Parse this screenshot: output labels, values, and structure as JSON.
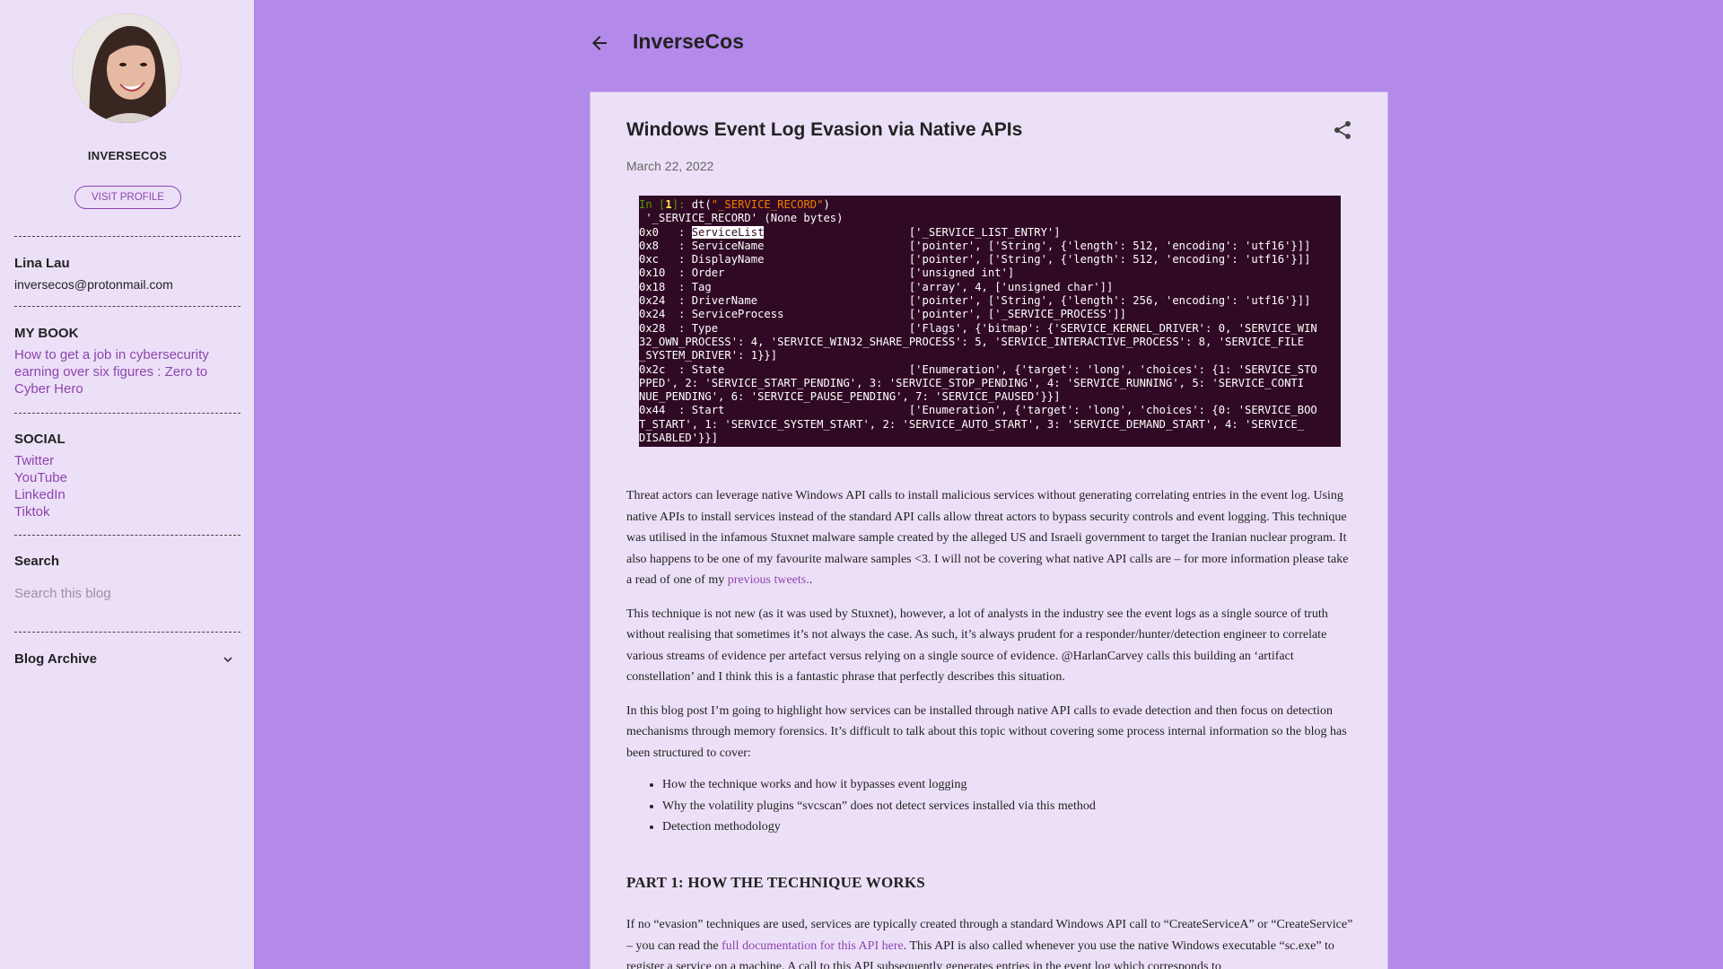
{
  "sidebar": {
    "profile_name": "INVERSECOS",
    "visit_profile": "VISIT PROFILE",
    "author": {
      "name": "Lina Lau",
      "email": "inversecos@protonmail.com"
    },
    "my_book": {
      "heading": "MY BOOK",
      "link": "How to get a job in cybersecurity earning over six figures : Zero to Cyber Hero"
    },
    "social": {
      "heading": "SOCIAL",
      "links": [
        "Twitter",
        "YouTube",
        "LinkedIn",
        "Tiktok"
      ]
    },
    "search": {
      "heading": "Search",
      "placeholder": "Search this blog"
    },
    "archive": {
      "heading": "Blog Archive"
    }
  },
  "header": {
    "title": "InverseCos"
  },
  "post": {
    "title": "Windows Event Log Evasion via Native APIs",
    "date": "March 22, 2022",
    "terminal": {
      "prompt_in": "In [",
      "prompt_num": "1",
      "prompt_close": "]: ",
      "command_pre": "dt(",
      "command_arg": "\"_SERVICE_RECORD\"",
      "command_post": ")",
      "lines": [
        " '_SERVICE_RECORD' (None bytes)",
        "0x8   : ServiceName                      ['pointer', ['String', {'length': 512, 'encoding': 'utf16'}]]",
        "0xc   : DisplayName                      ['pointer', ['String', {'length': 512, 'encoding': 'utf16'}]]",
        "0x10  : Order                            ['unsigned int']",
        "0x18  : Tag                              ['array', 4, ['unsigned char']]",
        "0x24  : DriverName                       ['pointer', ['String', {'length': 256, 'encoding': 'utf16'}]]",
        "0x24  : ServiceProcess                   ['pointer', ['_SERVICE_PROCESS']]",
        "0x28  : Type                             ['Flags', {'bitmap': {'SERVICE_KERNEL_DRIVER': 0, 'SERVICE_WIN",
        "32_OWN_PROCESS': 4, 'SERVICE_WIN32_SHARE_PROCESS': 5, 'SERVICE_INTERACTIVE_PROCESS': 8, 'SERVICE_FILE",
        "_SYSTEM_DRIVER': 1}}]",
        "0x2c  : State                            ['Enumeration', {'target': 'long', 'choices': {1: 'SERVICE_STO",
        "PPED', 2: 'SERVICE_START_PENDING', 3: 'SERVICE_STOP_PENDING', 4: 'SERVICE_RUNNING', 5: 'SERVICE_CONTI",
        "NUE_PENDING', 6: 'SERVICE_PAUSE_PENDING', 7: 'SERVICE_PAUSED'}}]",
        "0x44  : Start                            ['Enumeration', {'target': 'long', 'choices': {0: 'SERVICE_BOO",
        "T_START', 1: 'SERVICE_SYSTEM_START', 2: 'SERVICE_AUTO_START', 3: 'SERVICE_DEMAND_START', 4: 'SERVICE_",
        "DISABLED'}}]"
      ],
      "row0_prefix": "0x0   : ",
      "row0_field": "ServiceList",
      "row0_value": "                      ['_SERVICE_LIST_ENTRY']"
    },
    "p1": "Threat actors can leverage native Windows API calls to install malicious services without generating correlating entries in the event log. Using native APIs to install services instead of the standard API calls allow threat actors to bypass security controls and event logging. This technique was utilised in the infamous Stuxnet malware sample created by the alleged US and Israeli government to target the Iranian nuclear program. It also happens to be one of my favourite malware samples <3. I will not be covering what native API calls are – for more information please take a read of one of my ",
    "p1_link": "previous tweets.",
    "p1_end": ".",
    "p2": "This technique is not new (as it was used by Stuxnet), however, a lot of analysts in the industry see the event logs as a single source of truth without realising that sometimes it’s not always the case. As such, it’s always prudent for a responder/hunter/detection engineer to correlate various streams of evidence per artefact versus relying on a single source of evidence. @HarlanCarvey calls this building an ‘artifact constellation’ and I think this is a fantastic phrase that perfectly describes this situation.",
    "p3": "In this blog post I’m going to highlight how services can be installed through native API calls to evade detection and then focus on detection mechanisms through memory forensics. It’s difficult to talk about this topic without covering some process internal information so the blog has been structured to cover:",
    "bullets": [
      "How the technique works and how it bypasses event logging",
      "Why the volatility plugins “svcscan” does not detect services installed via this method",
      "Detection methodology"
    ],
    "h2": "PART 1: HOW THE TECHNIQUE WORKS",
    "p4_a": "If no “evasion” techniques are used, services are typically created through a standard Windows API call to “CreateServiceA” or “CreateService” – you can read the ",
    "p4_link": "full documentation for this API here",
    "p4_b": ". This API is also called whenever you use the native Windows executable “sc.exe” to register a service on a machine. A call to this API subsequently generates entries in the event log which corresponds to"
  }
}
